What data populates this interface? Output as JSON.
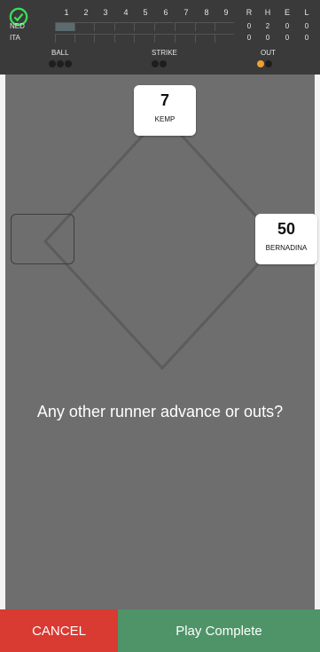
{
  "scoreboard": {
    "innings": [
      "1",
      "2",
      "3",
      "4",
      "5",
      "6",
      "7",
      "8",
      "9"
    ],
    "rhe_headers": [
      "R",
      "H",
      "E",
      "L"
    ],
    "teams": [
      {
        "name": "NED",
        "rhe": [
          "0",
          "2",
          "0",
          "0"
        ]
      },
      {
        "name": "ITA",
        "rhe": [
          "0",
          "0",
          "0",
          "0"
        ]
      }
    ],
    "count_labels": {
      "ball": "BALL",
      "strike": "STRIKE",
      "out": "OUT"
    },
    "balls": 0,
    "strikes": 0,
    "outs": 1,
    "accent_color": "#f0a030"
  },
  "field": {
    "second_base": {
      "number": "7",
      "name": "KEMP"
    },
    "first_base": {
      "number": "50",
      "name": "BERNADINA"
    },
    "third_base": null
  },
  "prompt": "Any other runner advance or outs?",
  "buttons": {
    "cancel": "CANCEL",
    "complete": "Play Complete",
    "cancel_color": "#d93a32",
    "complete_color": "#4e9468"
  }
}
